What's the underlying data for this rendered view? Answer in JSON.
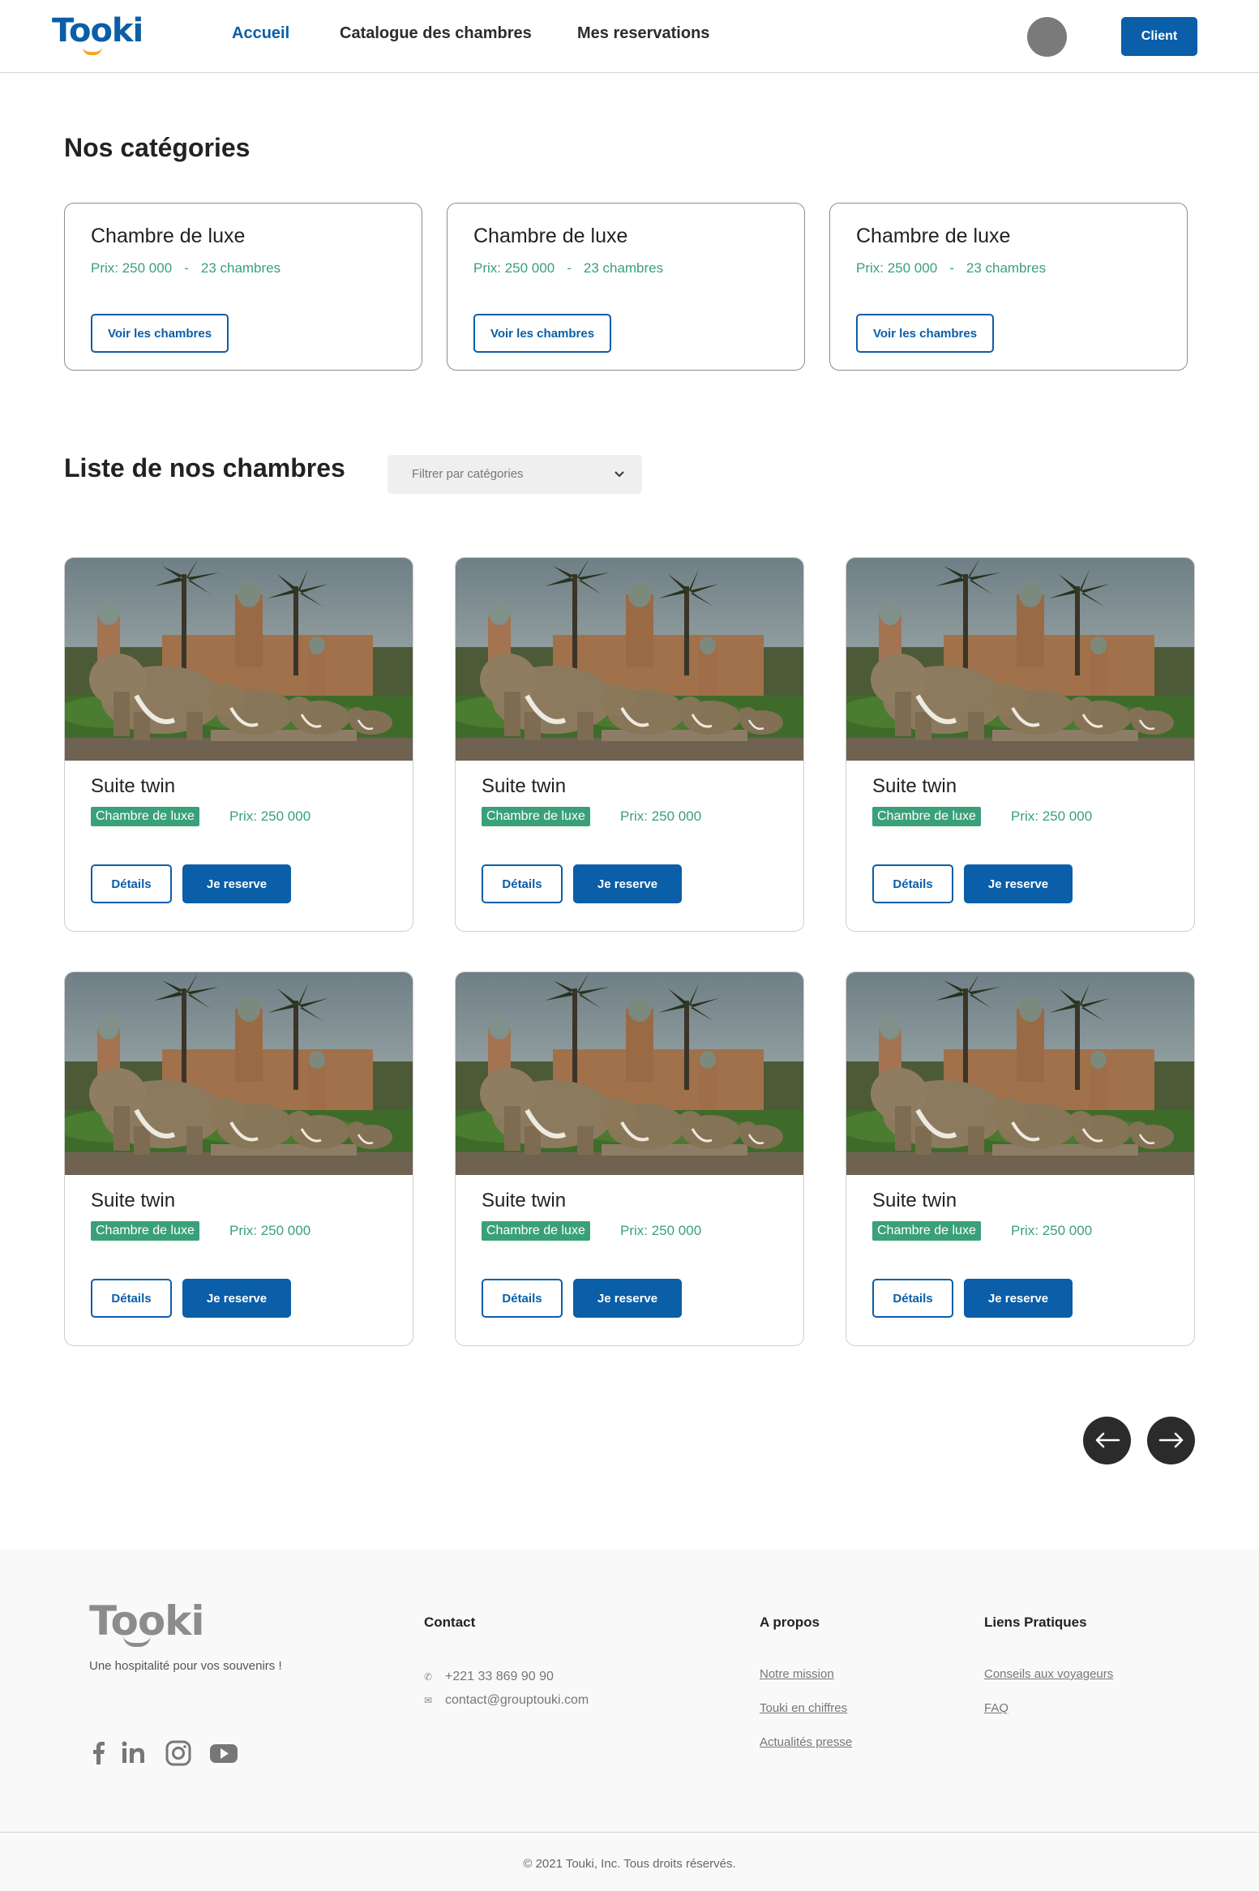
{
  "header": {
    "logo": "Tooki",
    "nav": [
      "Accueil",
      "Catalogue des chambres",
      "Mes reservations"
    ],
    "client_button": "Client"
  },
  "categories_section": {
    "title": "Nos catégories",
    "cards": [
      {
        "title": "Chambre de luxe",
        "price": "Prix: 250 000",
        "separator": "-",
        "count": "23 chambres",
        "button": "Voir les chambres"
      },
      {
        "title": "Chambre de luxe",
        "price": "Prix: 250 000",
        "separator": "-",
        "count": "23 chambres",
        "button": "Voir les chambres"
      },
      {
        "title": "Chambre de luxe",
        "price": "Prix: 250 000",
        "separator": "-",
        "count": "23 chambres",
        "button": "Voir les chambres"
      }
    ]
  },
  "rooms_section": {
    "title": "Liste de nos chambres",
    "filter_placeholder": "Filtrer par catégories",
    "rooms": [
      {
        "title": "Suite twin",
        "category": "Chambre de luxe",
        "price": "Prix: 250 000",
        "details_button": "Détails",
        "reserve_button": "Je reserve"
      },
      {
        "title": "Suite twin",
        "category": "Chambre de luxe",
        "price": "Prix: 250 000",
        "details_button": "Détails",
        "reserve_button": "Je reserve"
      },
      {
        "title": "Suite twin",
        "category": "Chambre de luxe",
        "price": "Prix: 250 000",
        "details_button": "Détails",
        "reserve_button": "Je reserve"
      },
      {
        "title": "Suite twin",
        "category": "Chambre de luxe",
        "price": "Prix: 250 000",
        "details_button": "Détails",
        "reserve_button": "Je reserve"
      },
      {
        "title": "Suite twin",
        "category": "Chambre de luxe",
        "price": "Prix: 250 000",
        "details_button": "Détails",
        "reserve_button": "Je reserve"
      },
      {
        "title": "Suite twin",
        "category": "Chambre de luxe",
        "price": "Prix: 250 000",
        "details_button": "Détails",
        "reserve_button": "Je reserve"
      }
    ]
  },
  "pagination": {
    "prev_icon": "arrow-left-icon",
    "next_icon": "arrow-right-icon"
  },
  "footer": {
    "logo": "Tooki",
    "tagline": "Une hospitalité pour vos souvenirs !",
    "social": [
      "facebook-icon",
      "linkedin-icon",
      "instagram-icon",
      "youtube-icon"
    ],
    "contact": {
      "title": "Contact",
      "phone": "+221 33 869 90 90",
      "email": "contact@grouptouki.com"
    },
    "about": {
      "title": "A propos",
      "links": [
        "Notre mission",
        "Touki en chiffres",
        "Actualités presse"
      ]
    },
    "useful_links": {
      "title": "Liens Pratiques",
      "links": [
        "Conseils aux voyageurs",
        "FAQ"
      ]
    },
    "copyright": "© 2021 Touki, Inc. Tous droits réservés."
  },
  "colors": {
    "primary": "#0b5ea8",
    "accent_green": "#3aa07a",
    "logo_smile": "#f5a623",
    "dark_button": "#2b2b2b"
  }
}
